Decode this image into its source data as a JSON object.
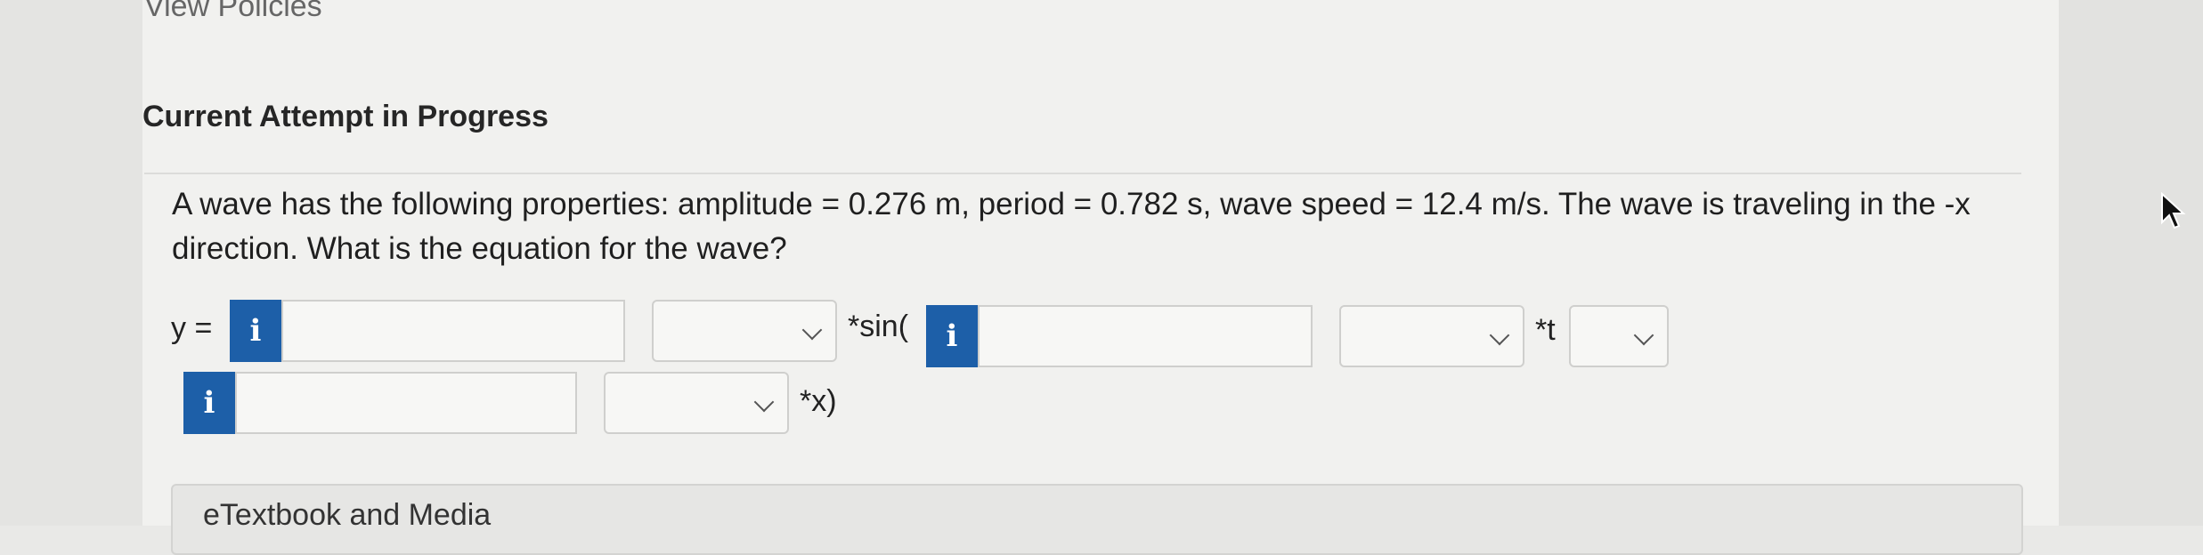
{
  "header": {
    "view_policies": "View Policies",
    "attempt_title": "Current Attempt in Progress"
  },
  "question": {
    "text": "A wave has the following properties: amplitude = 0.276 m, period = 0.782 s, wave speed = 12.4 m/s. The wave is traveling in the -x direction. What is the equation for the wave?"
  },
  "equation": {
    "y_label": "y =",
    "sin_label": "*sin(",
    "t_label": "*t",
    "x_label": "*x)",
    "info_glyph": "i",
    "amplitude_value": "",
    "amplitude_unit": "",
    "omega_value": "",
    "omega_unit": "",
    "t_unit": "",
    "k_value": "",
    "k_unit": ""
  },
  "footer": {
    "etextbook_label": "eTextbook and Media"
  },
  "colors": {
    "info_button": "#1d5fa8",
    "panel_background": "#f1f1ef"
  }
}
